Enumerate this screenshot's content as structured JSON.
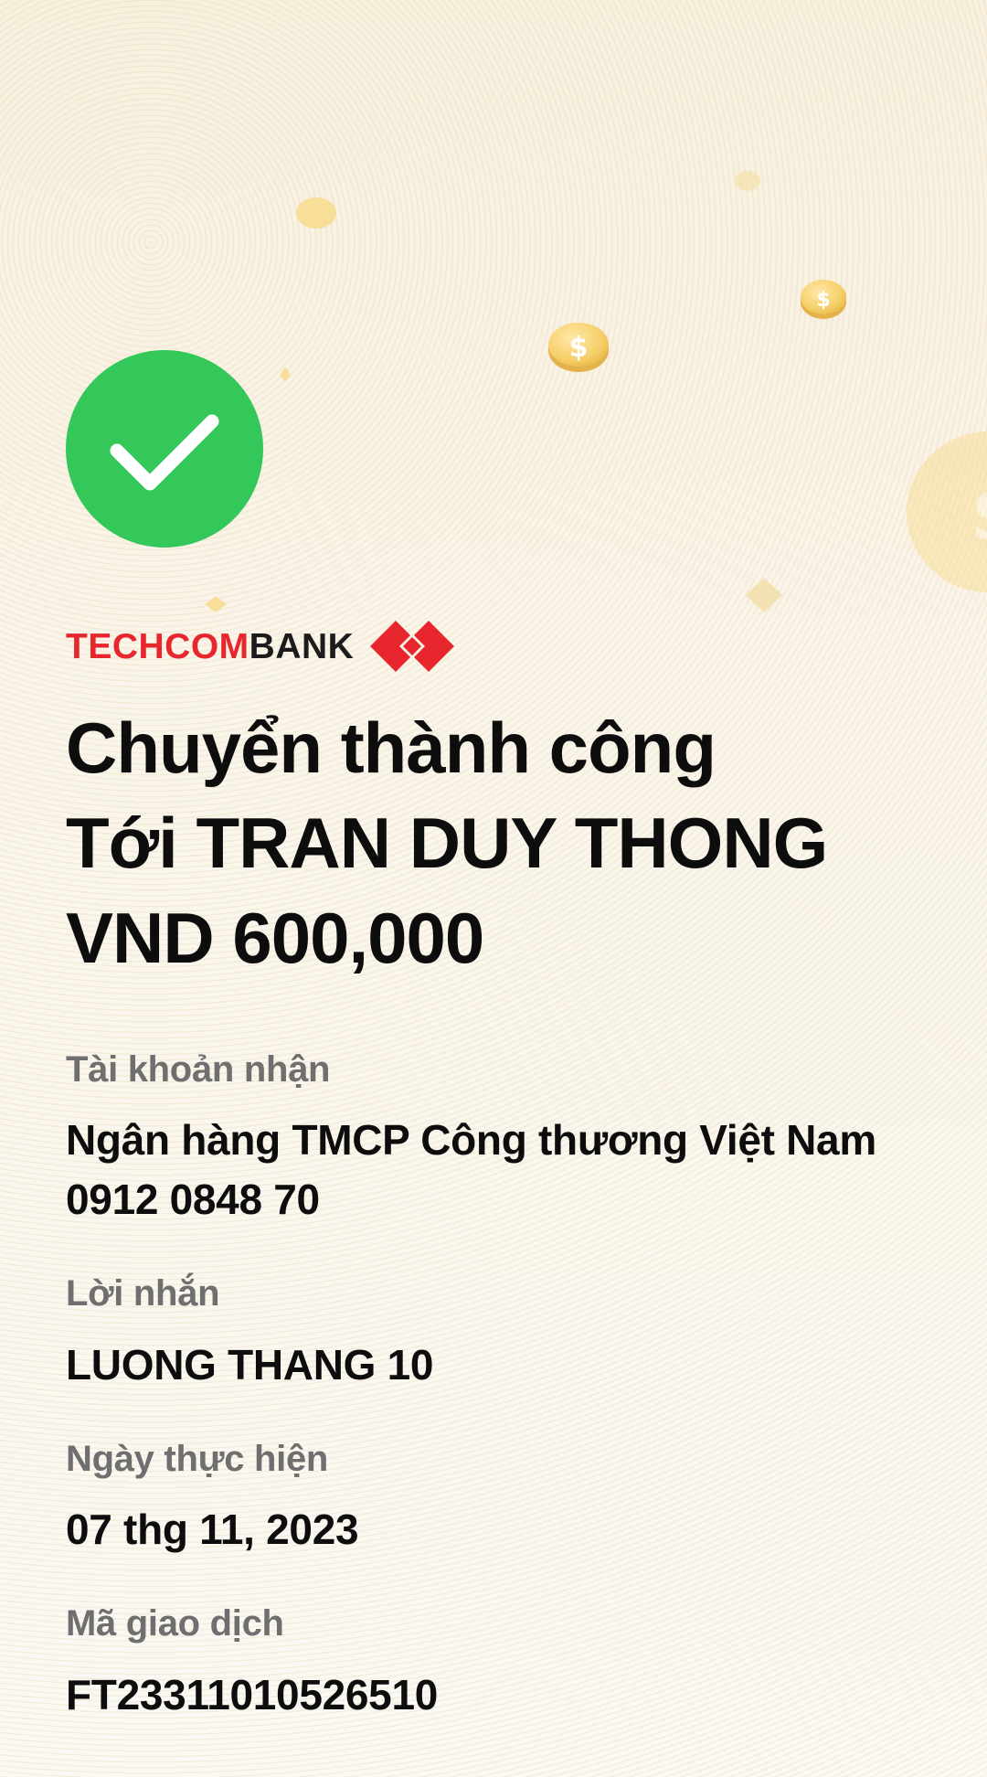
{
  "brand": {
    "logo_part_red": "TECHCOM",
    "logo_part_black": "BANK",
    "red_color": "#e8262d"
  },
  "status": {
    "icon": "check-circle-icon",
    "color": "#34c759"
  },
  "headline": {
    "line1": "Chuyển thành công",
    "line2": "Tới TRAN DUY THONG",
    "line3": "VND 600,000"
  },
  "details": {
    "account": {
      "label": "Tài khoản nhận",
      "bank": "Ngân hàng TMCP Công thương Việt Nam",
      "number": "0912 0848 70"
    },
    "message": {
      "label": "Lời nhắn",
      "value": "LUONG THANG 10"
    },
    "date": {
      "label": "Ngày thực hiện",
      "value": "07 thg 11, 2023"
    },
    "transaction": {
      "label": "Mã giao dịch",
      "value": "FT23311010526510"
    }
  },
  "decorations": {
    "coin_icon": "dollar-coin-icon",
    "coin_color": "#f6cf6a"
  }
}
